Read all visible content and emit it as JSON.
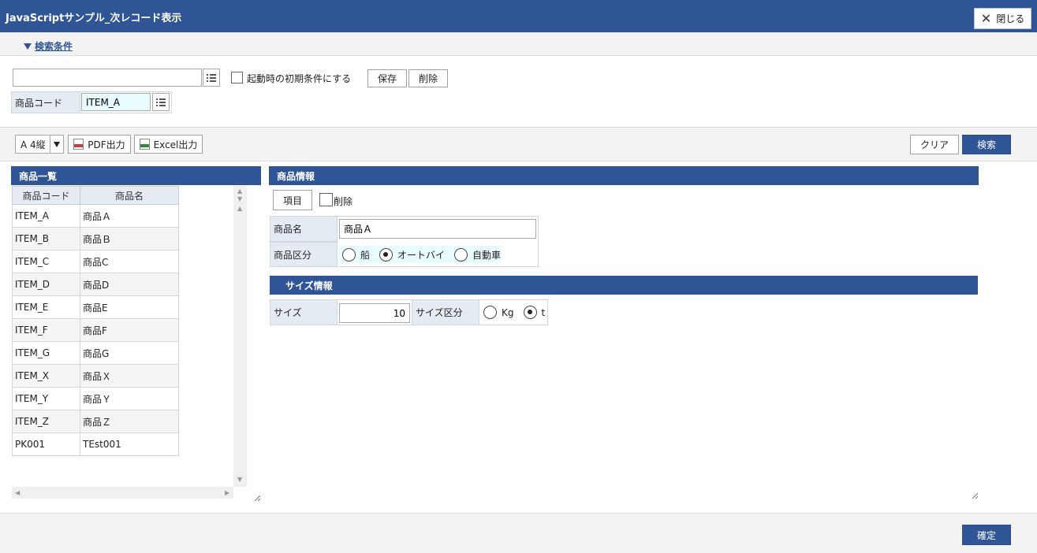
{
  "window": {
    "title": "JavaScriptサンプル_次レコード表示",
    "close_label": "閉じる"
  },
  "search": {
    "toggle_label": "検索条件",
    "condition_value": "",
    "initial_checkbox_label": "起動時の初期条件にする",
    "save_label": "保存",
    "delete_label": "削除",
    "code_label": "商品コード",
    "code_value": "ITEM_A"
  },
  "toolbar": {
    "paper_select": "A 4縦",
    "pdf_label": "PDF出力",
    "excel_label": "Excel出力",
    "clear_label": "クリア",
    "search_label": "検索"
  },
  "list": {
    "header": "商品一覧",
    "columns": [
      "商品コード",
      "商品名"
    ],
    "rows": [
      [
        "ITEM_A",
        "商品Ａ"
      ],
      [
        "ITEM_B",
        "商品Ｂ"
      ],
      [
        "ITEM_C",
        "商品C"
      ],
      [
        "ITEM_D",
        "商品D"
      ],
      [
        "ITEM_E",
        "商品E"
      ],
      [
        "ITEM_F",
        "商品F"
      ],
      [
        "ITEM_G",
        "商品G"
      ],
      [
        "ITEM_X",
        "商品Ｘ"
      ],
      [
        "ITEM_Y",
        "商品Ｙ"
      ],
      [
        "ITEM_Z",
        "商品Ｚ"
      ],
      [
        "PK001",
        "TEst001"
      ]
    ]
  },
  "detail": {
    "header": "商品情報",
    "item_button": "項目",
    "delete_checkbox_label": "削除",
    "name_label": "商品名",
    "name_value": "商品Ａ",
    "category_label": "商品区分",
    "category_options": [
      "船",
      "オートバイ",
      "自動車"
    ],
    "category_selected": "オートバイ"
  },
  "size": {
    "header": "サイズ情報",
    "size_label": "サイズ",
    "size_value": "10",
    "unit_label": "サイズ区分",
    "unit_options": [
      "Kg",
      "t"
    ],
    "unit_selected": "t"
  },
  "footer": {
    "confirm_label": "確定"
  },
  "colors": {
    "accent": "#2f5597",
    "label_bg": "#e5ebf2",
    "highlight": "#e8fbff"
  }
}
